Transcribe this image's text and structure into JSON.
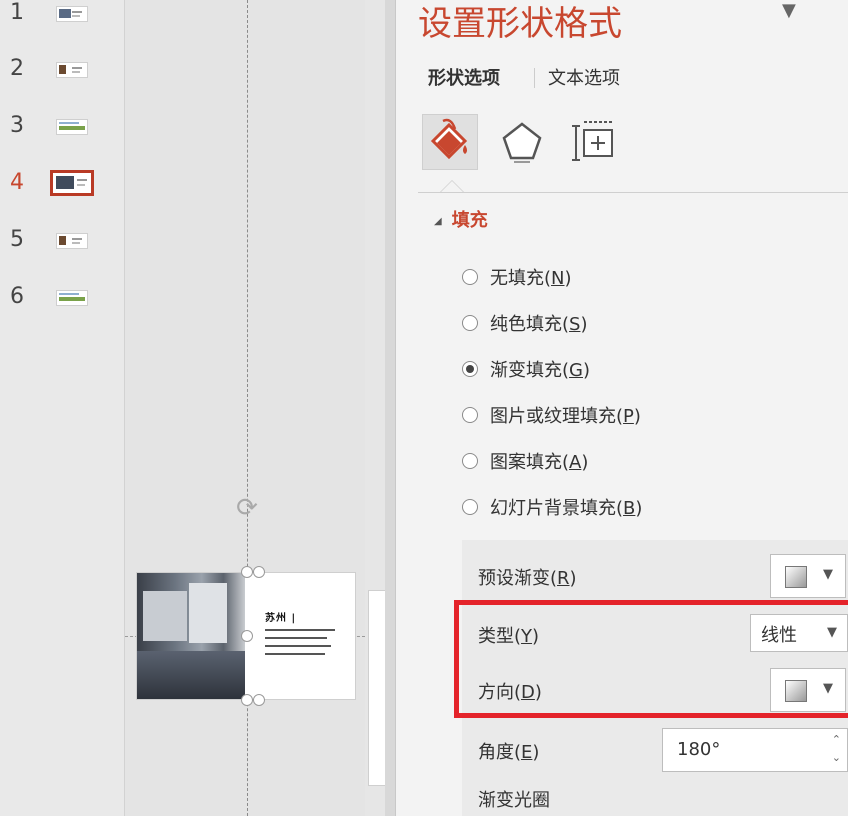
{
  "thumbnails": [
    {
      "number": "1",
      "active": false
    },
    {
      "number": "2",
      "active": false
    },
    {
      "number": "3",
      "active": false
    },
    {
      "number": "4",
      "active": true
    },
    {
      "number": "5",
      "active": false
    },
    {
      "number": "6",
      "active": false
    }
  ],
  "slide": {
    "title": "苏州 | "
  },
  "pane": {
    "title": "设置形状格式",
    "tabs": [
      "形状选项",
      "文本选项"
    ],
    "icons": [
      "fill-bucket-icon",
      "pentagon-effects-icon",
      "size-properties-icon"
    ],
    "section_title": "填充",
    "fill_options": [
      {
        "label": "无填充",
        "key": "N",
        "selected": false
      },
      {
        "label": "纯色填充",
        "key": "S",
        "selected": false
      },
      {
        "label": "渐变填充",
        "key": "G",
        "selected": true
      },
      {
        "label": "图片或纹理填充",
        "key": "P",
        "selected": false
      },
      {
        "label": "图案填充",
        "key": "A",
        "selected": false
      },
      {
        "label": "幻灯片背景填充",
        "key": "B",
        "selected": false
      }
    ],
    "gradient": {
      "preset_label": "预设渐变",
      "preset_key": "R",
      "type_label": "类型",
      "type_key": "Y",
      "type_value": "线性",
      "direction_label": "方向",
      "direction_key": "D",
      "angle_label": "角度",
      "angle_key": "E",
      "angle_value": "180°",
      "stops_label": "渐变光圈"
    }
  },
  "colors": {
    "accent": "#c8472f",
    "highlight": "#e4232a"
  }
}
